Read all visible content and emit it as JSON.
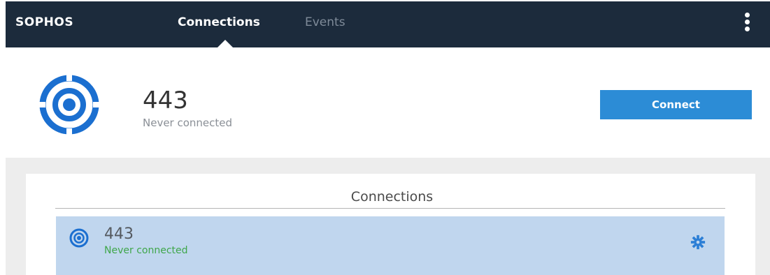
{
  "brand": "SOPHOS",
  "nav": {
    "tabs": [
      {
        "label": "Connections",
        "active": true
      },
      {
        "label": "Events",
        "active": false
      }
    ],
    "menu_icon": "kebab-menu-icon"
  },
  "header": {
    "title": "443",
    "status": "Never connected",
    "connect_label": "Connect"
  },
  "connections_panel": {
    "title": "Connections",
    "items": [
      {
        "name": "443",
        "status": "Never connected",
        "icon": "connection-target-icon",
        "settings_icon": "gear-icon"
      }
    ]
  },
  "colors": {
    "topbar": "#1c2b3c",
    "accent": "#2c8cd6",
    "selected_row": "#c0d6ee",
    "status_green": "#3fa64a"
  }
}
